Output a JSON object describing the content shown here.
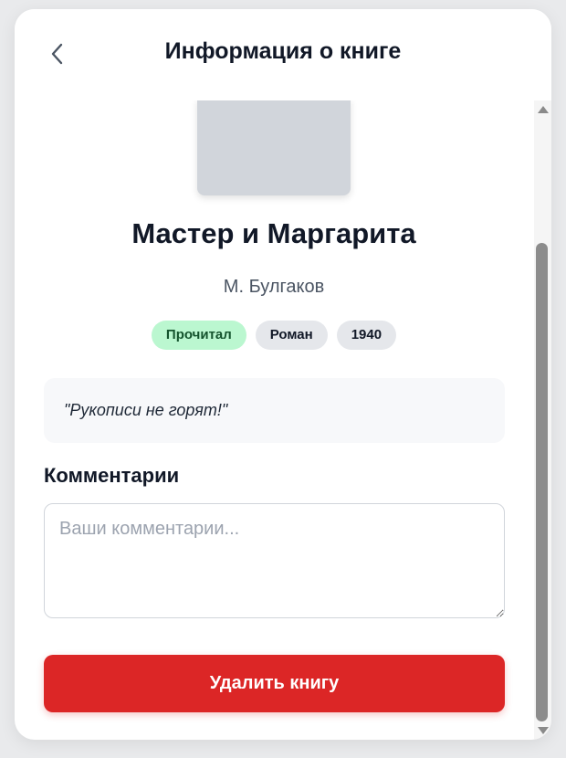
{
  "header": {
    "title": "Информация о книге",
    "back_icon": "chevron-left-icon"
  },
  "book": {
    "title": "Мастер и Маргарита",
    "author": "М. Булгаков",
    "tags": [
      {
        "label": "Прочитал",
        "kind": "status",
        "color": "#bbf7d0"
      },
      {
        "label": "Роман",
        "kind": "genre",
        "color": "#e5e7eb"
      },
      {
        "label": "1940",
        "kind": "year",
        "color": "#e5e7eb"
      }
    ],
    "quote": "\"Рукописи не горят!\""
  },
  "comments": {
    "section_title": "Комментарии",
    "placeholder": "Ваши комментарии...",
    "value": ""
  },
  "actions": {
    "delete_label": "Удалить книгу",
    "delete_color": "#dc2626"
  },
  "colors": {
    "accent_danger": "#dc2626",
    "status_green": "#bbf7d0",
    "cover_placeholder": "#d1d5db"
  }
}
